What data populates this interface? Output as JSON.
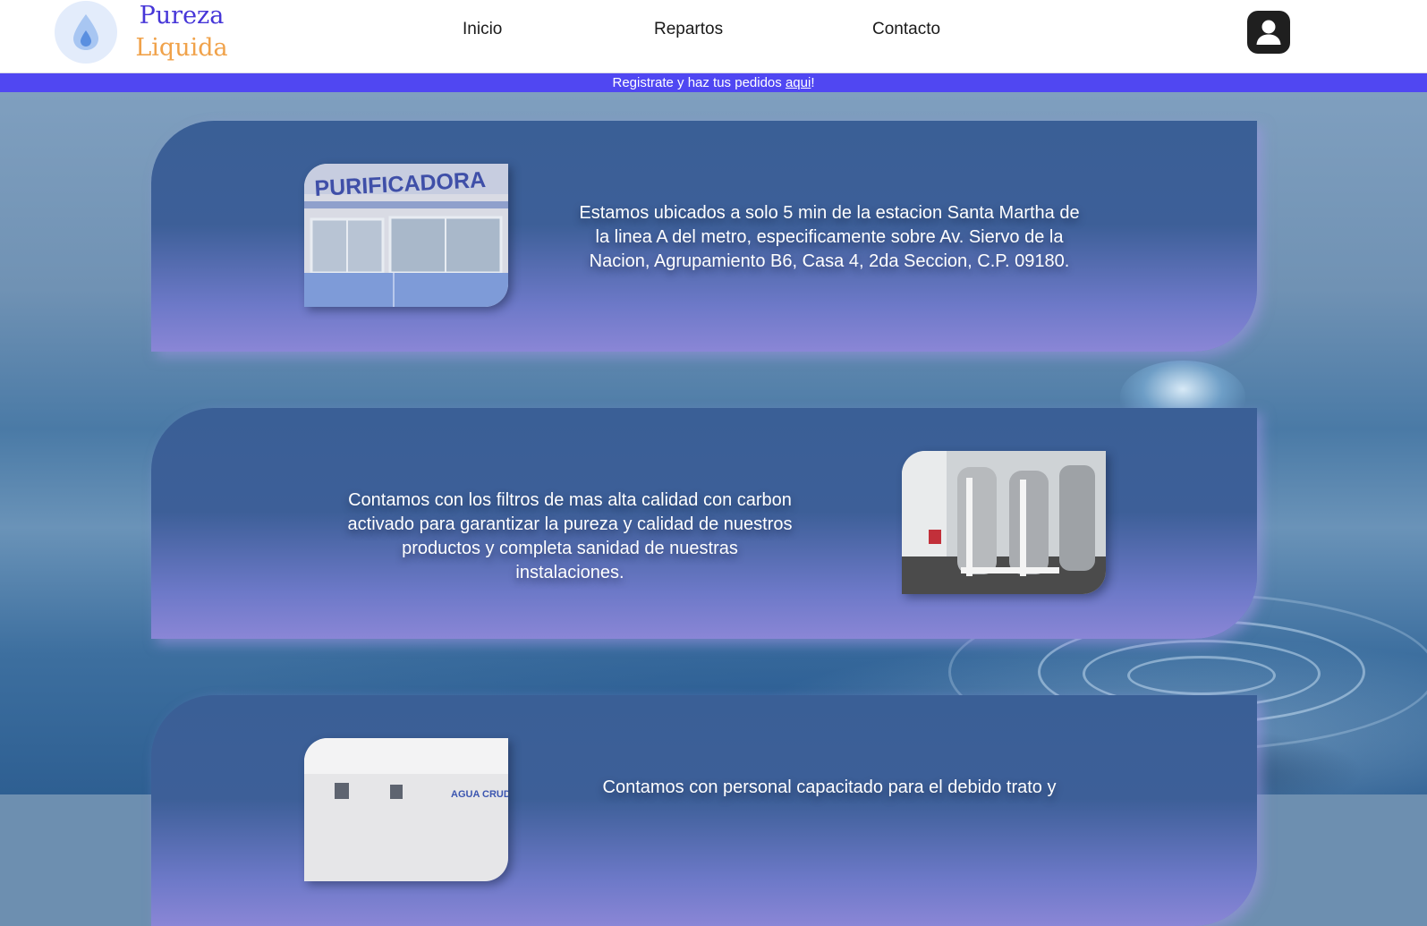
{
  "brand": {
    "line1": "Pureza",
    "line2": "Liquida"
  },
  "nav": {
    "items": [
      "Inicio",
      "Repartos",
      "Contacto"
    ]
  },
  "announcement": {
    "prefix": "Registrate y haz tus pedidos ",
    "link": "aqui",
    "suffix": "!"
  },
  "cards": [
    {
      "text": "Estamos ubicados a solo 5 min de la estacion Santa Martha de la linea A del metro, especificamente sobre Av. Siervo de la Nacion, Agrupamiento B6, Casa 4, 2da Seccion, C.P. 09180.",
      "photo_sign": "PURIFICADORA"
    },
    {
      "text": "Contamos con los filtros de mas alta calidad con carbon activado para garantizar la pureza y calidad de nuestros productos y completa sanidad de nuestras instalaciones."
    },
    {
      "text": "Contamos con personal capacitado para el debido trato y",
      "photo_sign": "AGUA CRUDA"
    }
  ],
  "colors": {
    "announcement_bar": "#5047f2",
    "brand_blue": "#4636d8",
    "brand_orange": "#f0a24a",
    "card_top": "#3a5f96",
    "card_bottom": "#8a86d6"
  },
  "icons": {
    "logo": "water-drop-icon",
    "user": "user-account-icon"
  }
}
